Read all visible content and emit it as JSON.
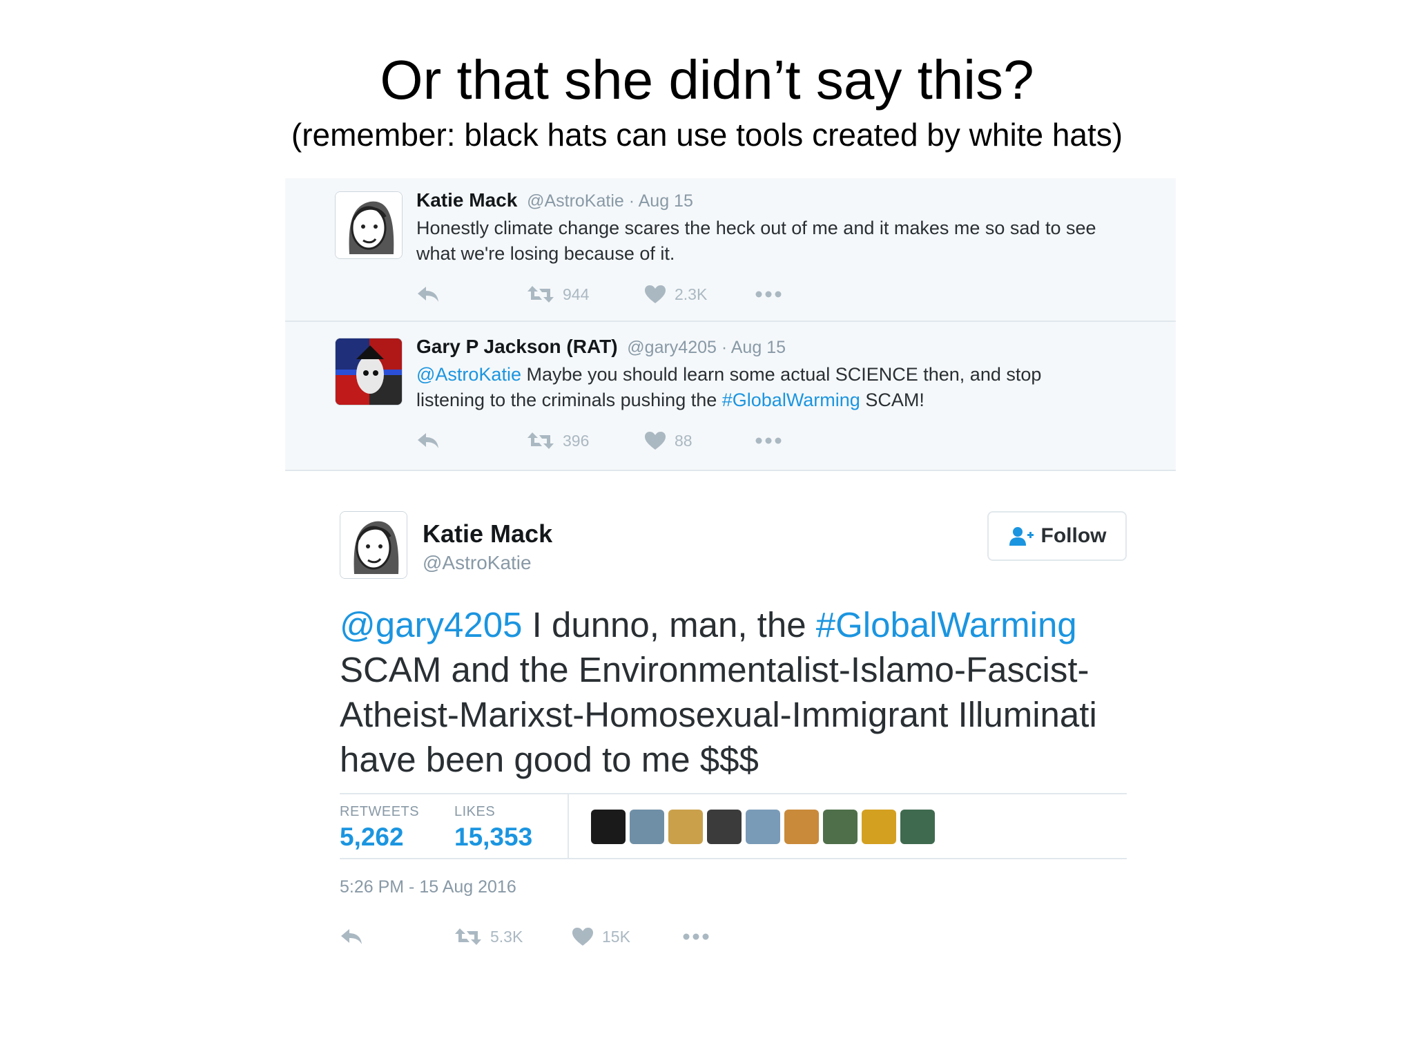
{
  "slide": {
    "title": "Or that she didn’t say this?",
    "subtitle": "(remember: black hats can use tools created by white hats)"
  },
  "thread": [
    {
      "name": "Katie Mack",
      "handle": "@AstroKatie · Aug 15",
      "text_parts": [
        {
          "type": "text",
          "value": "Honestly climate change scares the heck out of me and it makes me so sad to see what we're losing because of it."
        }
      ],
      "retweets": "944",
      "likes": "2.3K"
    },
    {
      "name": "Gary P Jackson (RAT)",
      "handle": "@gary4205 · Aug 15",
      "text_parts": [
        {
          "type": "mention",
          "value": "@AstroKatie"
        },
        {
          "type": "text",
          "value": " Maybe you should learn some actual SCIENCE then, and stop listening to the criminals pushing the "
        },
        {
          "type": "hashtag",
          "value": "#GlobalWarming"
        },
        {
          "type": "text",
          "value": " SCAM!"
        }
      ],
      "retweets": "396",
      "likes": "88"
    }
  ],
  "main_tweet": {
    "name": "Katie Mack",
    "handle": "@AstroKatie",
    "follow_label": "Follow",
    "text_parts": [
      {
        "type": "mention",
        "value": "@gary4205"
      },
      {
        "type": "text",
        "value": " I dunno, man, the "
      },
      {
        "type": "hashtag",
        "value": "#GlobalWarming"
      },
      {
        "type": "text",
        "value": " SCAM and the Environmentalist-Islamo-Fascist-Atheist-Marixst-Homosexual-Immigrant Illuminati have been good to me $$$"
      }
    ],
    "retweets_label": "RETWEETS",
    "retweets_value": "5,262",
    "likes_label": "LIKES",
    "likes_value": "15,353",
    "timestamp": "5:26 PM - 15 Aug 2016",
    "action_retweets": "5.3K",
    "action_likes": "15K"
  },
  "icons": {
    "reply": "reply-arrow-icon",
    "retweet": "retweet-icon",
    "like": "heart-icon",
    "more": "more-dots-icon",
    "follow": "add-user-icon"
  },
  "colors": {
    "link": "#1b95e0",
    "muted": "#aab8c2",
    "thread_bg": "#f5f8fa"
  },
  "liker_colors": [
    "#1a1a1a",
    "#6f8fa6",
    "#caa04a",
    "#3b3b3b",
    "#7a9bb8",
    "#c98a3a",
    "#4f6f4a",
    "#d4a020",
    "#3f6a4f"
  ]
}
